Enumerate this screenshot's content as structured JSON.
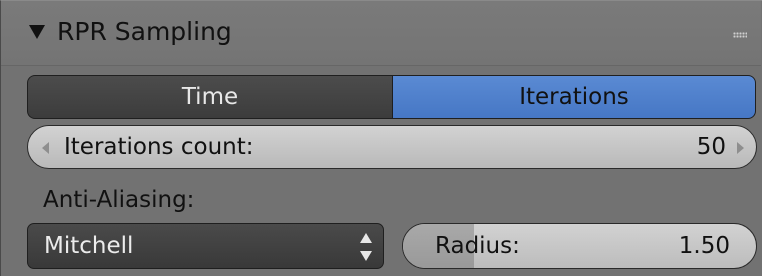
{
  "panel": {
    "title": "RPR Sampling"
  },
  "mode_toggle": {
    "options": [
      "Time",
      "Iterations"
    ],
    "selected": "Iterations",
    "selected_color": "#5a8ad3"
  },
  "iterations_count": {
    "label": "Iterations count:",
    "value": "50"
  },
  "anti_aliasing": {
    "label": "Anti-Aliasing:",
    "filter": "Mitchell",
    "radius_label": "Radius:",
    "radius_value": "1.50",
    "radius_fill_fraction": 0.2
  },
  "icons": {
    "collapse": "triangle-down",
    "grip": "drag-grip",
    "dropdown": "up-down-arrows",
    "decrement": "left-arrow",
    "increment": "right-arrow"
  }
}
